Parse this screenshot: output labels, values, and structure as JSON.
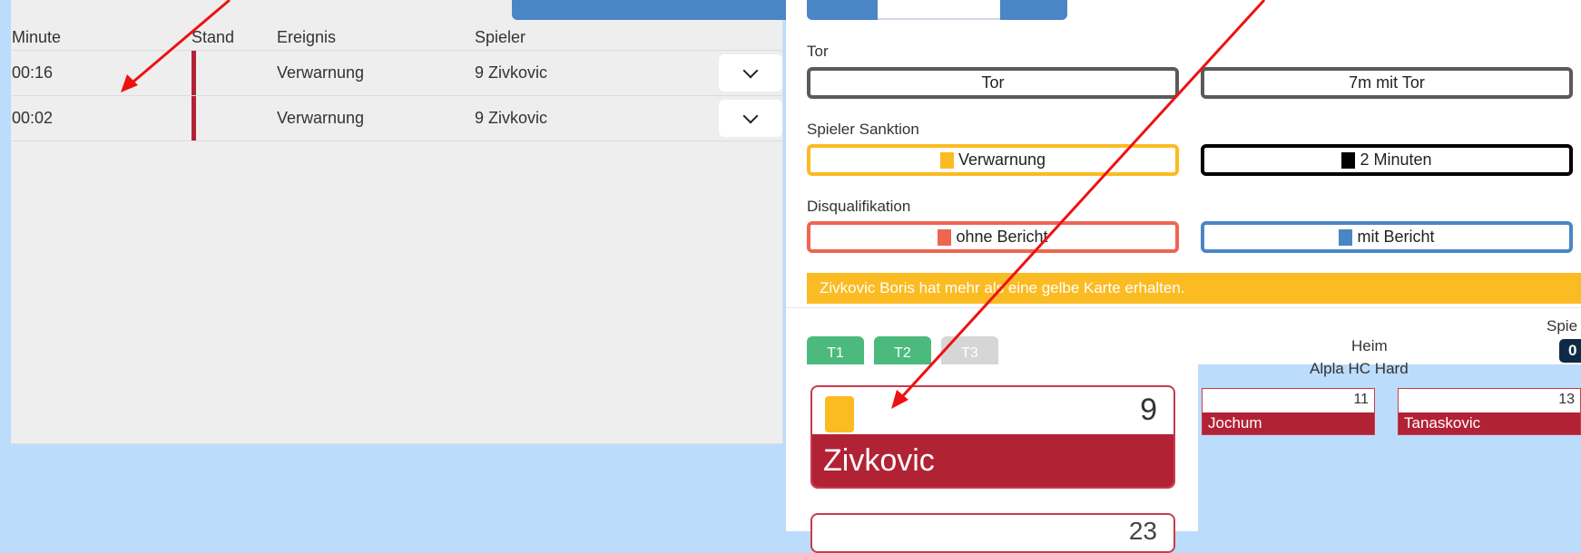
{
  "events": {
    "columns": {
      "minute": "Minute",
      "stand": "Stand",
      "event": "Ereignis",
      "player": "Spieler"
    },
    "rows": [
      {
        "minute": "00:16",
        "stand": "",
        "event": "Verwarnung",
        "player": "9 Zivkovic"
      },
      {
        "minute": "00:02",
        "stand": "",
        "event": "Verwarnung",
        "player": "9 Zivkovic"
      }
    ]
  },
  "actions": {
    "goal_label": "Tor",
    "goal_button": "Tor",
    "seven_m_button": "7m mit Tor",
    "sanction_label": "Spieler Sanktion",
    "warning_button": "Verwarnung",
    "two_min_button": "2 Minuten",
    "disq_label": "Disqualifikation",
    "no_report_button": "ohne Bericht",
    "with_report_button": "mit Bericht"
  },
  "alert": {
    "message": "Zivkovic Boris hat mehr als eine gelbe Karte erhalten."
  },
  "tabs": [
    {
      "label": "T1",
      "color": "#4cba7c"
    },
    {
      "label": "T2",
      "color": "#4cba7c"
    },
    {
      "label": "T3",
      "color": "#d6d6d6"
    }
  ],
  "team": {
    "side": "Heim",
    "name": "Alpla HC Hard",
    "spie_label": "Spie",
    "score": "0"
  },
  "players": {
    "selected": {
      "number": "9",
      "name": "Zivkovic"
    },
    "next_number": "23",
    "small": [
      {
        "number": "11",
        "name": "Jochum"
      },
      {
        "number": "13",
        "name": "Tanaskovic"
      }
    ]
  },
  "colors": {
    "warning_yellow": "#fbbb22",
    "two_min_black": "#000000",
    "no_report_red": "#ef6552",
    "with_report_blue": "#4a86c5",
    "team_red": "#b22235",
    "arrow": "#ee1111"
  }
}
